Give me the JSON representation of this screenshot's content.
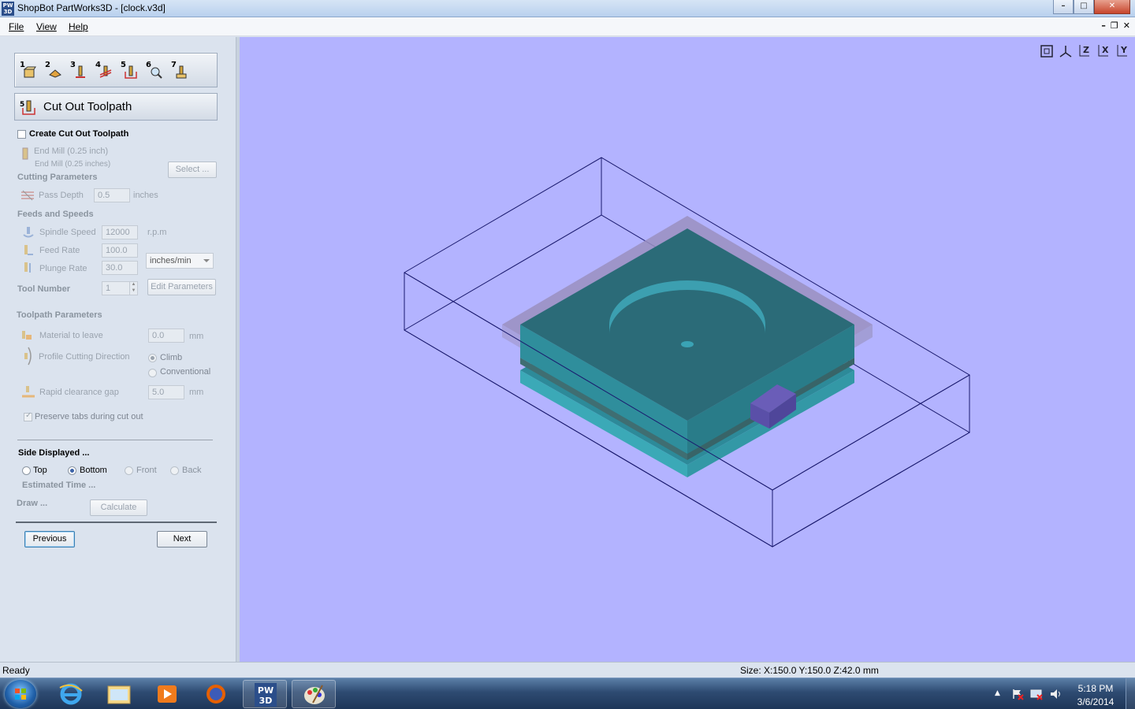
{
  "window": {
    "title": "ShopBot PartWorks3D - [clock.v3d]",
    "app_icon_text": "PW 3D",
    "minimize": "–",
    "maximize": "□",
    "close": "✕"
  },
  "menu": {
    "file": "File",
    "view": "View",
    "help": "Help",
    "mdi_min": "–",
    "mdi_restore": "❐",
    "mdi_close": "✕"
  },
  "toolstrip": {
    "steps": [
      "1",
      "2",
      "3",
      "4",
      "5",
      "6",
      "7"
    ]
  },
  "panel": {
    "title": "Cut Out Toolpath",
    "title_step": "5",
    "create_label": "Create Cut Out Toolpath",
    "tool_name": "End Mill (0.25 inch)",
    "tool_desc": "End Mill (0.25 inches)",
    "select_button": "Select ...",
    "cutting_params": "Cutting Parameters",
    "pass_depth_label": "Pass Depth",
    "pass_depth_value": "0.5",
    "pass_depth_unit": "inches",
    "feeds_speeds": "Feeds and Speeds",
    "spindle_label": "Spindle Speed",
    "spindle_value": "12000",
    "spindle_unit": "r.p.m",
    "feed_label": "Feed Rate",
    "feed_value": "100.0",
    "plunge_label": "Plunge Rate",
    "plunge_value": "30.0",
    "rate_unit": "inches/min",
    "tool_number_label": "Tool Number",
    "tool_number_value": "1",
    "edit_params_button": "Edit Parameters",
    "toolpath_params": "Toolpath Parameters",
    "material_label": "Material to leave",
    "material_value": "0.0",
    "material_unit": "mm",
    "direction_label": "Profile Cutting Direction",
    "climb": "Climb",
    "conventional": "Conventional",
    "rapid_label": "Rapid clearance gap",
    "rapid_value": "5.0",
    "rapid_unit": "mm",
    "preserve_tabs": "Preserve tabs during cut out",
    "side_displayed": "Side Displayed ...",
    "side_top": "Top",
    "side_bottom": "Bottom",
    "side_front": "Front",
    "side_back": "Back",
    "estimated_time": "Estimated Time ...",
    "draw": "Draw ...",
    "calculate_button": "Calculate",
    "previous_button": "Previous",
    "next_button": "Next"
  },
  "viewtools": {
    "fit": "fit-view-icon",
    "iso": "iso-view-icon",
    "z": "Z",
    "x": "X",
    "y": "Y"
  },
  "status": {
    "left": "Ready",
    "size": "Size: X:150.0 Y:150.0 Z:42.0 mm"
  },
  "taskbar": {
    "time": "5:18 PM",
    "date": "3/6/2014",
    "pw_icon_text": "PW 3D"
  },
  "colors": {
    "viewport_bg": "#b3b3ff",
    "panel_bg": "#dbe3ee",
    "part_top": "#2b6b78",
    "part_side": "#3aa0ae"
  }
}
